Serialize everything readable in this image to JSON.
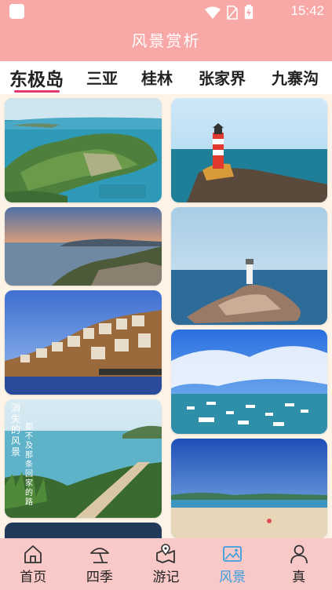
{
  "status_bar": {
    "time": "15:42",
    "icons": [
      "app-icon",
      "wifi-icon",
      "no-sim-icon",
      "battery-charging-icon"
    ]
  },
  "header": {
    "title": "风景赏析"
  },
  "tabs": [
    {
      "label": "东极岛",
      "active": true
    },
    {
      "label": "三亚",
      "active": false
    },
    {
      "label": "桂林",
      "active": false
    },
    {
      "label": "张家界",
      "active": false
    },
    {
      "label": "九寨沟",
      "active": false
    }
  ],
  "gallery": {
    "photos": [
      {
        "subject": "island-aerial-village"
      },
      {
        "subject": "lighthouse-on-rocks"
      },
      {
        "subject": "island-sunset-coast"
      },
      {
        "subject": "lighthouse-on-islet"
      },
      {
        "subject": "hillside-village"
      },
      {
        "subject": "harbor-boats-blue-sky"
      },
      {
        "subject": "coast-with-poem",
        "poem_line_1": "消失的风景",
        "poem_line_2": "都不及那条回家的路"
      },
      {
        "subject": "beach-blue-sky"
      }
    ]
  },
  "bottom_nav": {
    "items": [
      {
        "label": "首页",
        "icon": "home-icon",
        "active": false
      },
      {
        "label": "四季",
        "icon": "beach-umbrella-icon",
        "active": false
      },
      {
        "label": "游记",
        "icon": "map-pin-icon",
        "active": false
      },
      {
        "label": "风景",
        "icon": "picture-icon",
        "active": true
      },
      {
        "label": "真",
        "icon": "person-icon",
        "active": false
      }
    ]
  },
  "colors": {
    "header_bg": "#f8a8a6",
    "nav_bg": "#f8c9c7",
    "tab_indicator": "#e0386a",
    "active_nav": "#3a9ee0",
    "page_bg": "#fdf3e6"
  }
}
